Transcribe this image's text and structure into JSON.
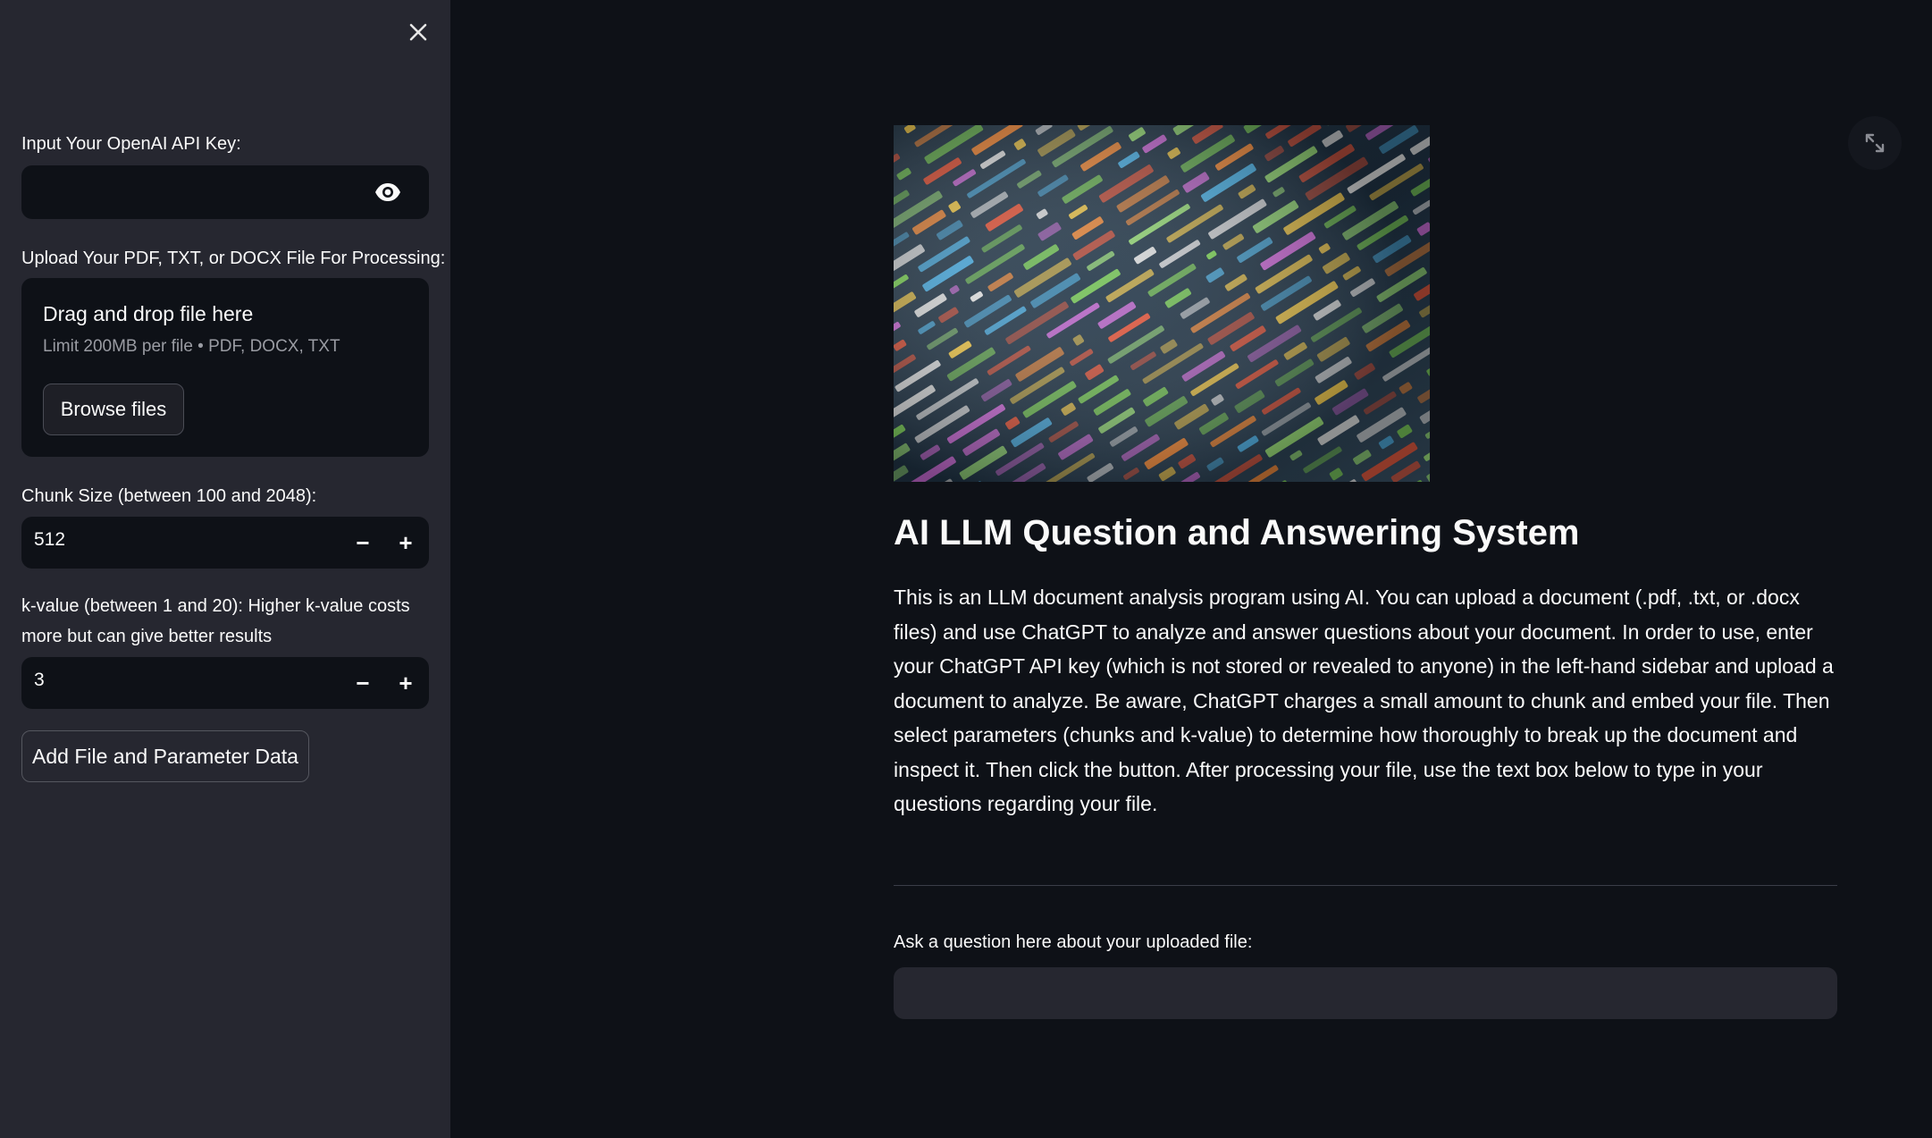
{
  "sidebar": {
    "api_key_label": "Input Your OpenAI API Key:",
    "api_key_value": "",
    "upload_label": "Upload Your PDF, TXT, or DOCX File For Processing:",
    "dropzone": {
      "title": "Drag and drop file here",
      "subtitle": "Limit 200MB per file • PDF, DOCX, TXT",
      "browse_label": "Browse files"
    },
    "chunk_label": "Chunk Size (between 100 and 2048):",
    "chunk_value": "512",
    "k_label_line1": "k-value (between 1 and 20): Higher k-value costs",
    "k_label_line2": "more but can give better results",
    "k_value": "3",
    "stepper_minus": "−",
    "stepper_plus": "+",
    "submit_label": "Add File and Parameter Data"
  },
  "main": {
    "title": "AI LLM Question and Answering System",
    "description": "This is an LLM document analysis program using AI. You can upload a document (.pdf, .txt, or .docx files) and use ChatGPT to analyze and answer questions about your document. In order to use, enter your ChatGPT API key (which is not stored or revealed to anyone) in the left-hand sidebar and upload a document to analyze. Be aware, ChatGPT charges a small amount to chunk and embed your file. Then select parameters (chunks and k-value) to determine how thoroughly to break up the document and inspect it. Then click the button. After processing your file, use the text box below to type in your questions regarding your file.",
    "question_label": "Ask a question here about your uploaded file:",
    "question_value": ""
  },
  "icons": {
    "close": "close-icon",
    "eye": "eye-icon",
    "expand": "expand-icon"
  },
  "colors": {
    "background": "#0e1117",
    "sidebar": "#262730",
    "input": "#0e1117",
    "text": "#fafafa"
  }
}
